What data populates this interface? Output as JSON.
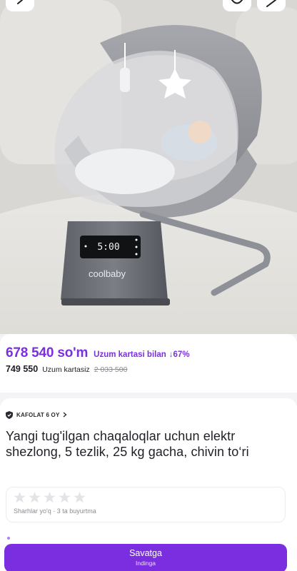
{
  "product_image": {
    "display_time": "5:00",
    "brand": "coolbaby"
  },
  "price": {
    "main": "678 540 so'm",
    "main_note": "Uzum kartasi bilan",
    "discount": "↓67%",
    "without_card": "749 550",
    "without_card_note": "Uzum kartasiz",
    "old": "2 033 500"
  },
  "warranty": {
    "label": "KAFOLAT 6 OY"
  },
  "product": {
    "title": "Yangi tug'ilgan chaqaloqlar uchun elektr shezlong, 5 tezlik, 25 kg gacha, chivin to‘ri"
  },
  "rating": {
    "stars_filled": 0,
    "stars_total": 5,
    "summary": "Sharhlar yo'q · 3 ta buyurtma"
  },
  "cart_button": {
    "label": "Savatga",
    "sublabel": "Indinga"
  },
  "colors": {
    "accent": "#7b2ee0",
    "text": "#1f2026",
    "muted": "#8c8c93"
  }
}
